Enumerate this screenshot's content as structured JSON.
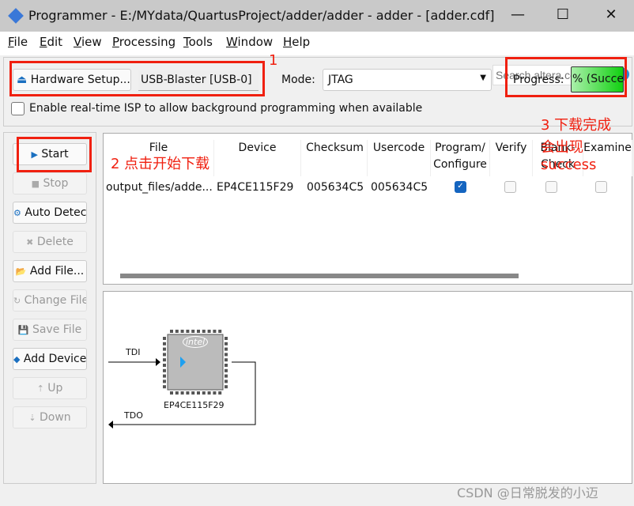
{
  "window": {
    "title": "Programmer - E:/MYdata/QuartusProject/adder/adder - adder - [adder.cdf]",
    "minimize": "—",
    "maximize": "☐",
    "close": "✕"
  },
  "menu": [
    {
      "k": "F",
      "r": "ile"
    },
    {
      "k": "E",
      "r": "dit"
    },
    {
      "k": "V",
      "r": "iew"
    },
    {
      "k": "P",
      "r": "rocessing"
    },
    {
      "k": "T",
      "r": "ools"
    },
    {
      "k": "W",
      "r": "indow"
    },
    {
      "k": "H",
      "r": "elp"
    }
  ],
  "search": {
    "placeholder": "Search altera.com"
  },
  "toolbar": {
    "hardware_setup": "Hardware Setup...",
    "hardware": "USB-Blaster [USB-0]",
    "mode_label": "Mode:",
    "mode": "JTAG",
    "progress_label": "Progress:",
    "progress_text": "% (Succes",
    "progress_percent": 100,
    "isp_label": "Enable real-time ISP to allow background programming when available"
  },
  "side_buttons": [
    {
      "label": "Start",
      "enabled": true
    },
    {
      "label": "Stop",
      "enabled": false
    },
    {
      "label": "Auto Detec",
      "enabled": true
    },
    {
      "label": "Delete",
      "enabled": false
    },
    {
      "label": "Add File...",
      "enabled": true
    },
    {
      "label": "Change File",
      "enabled": false
    },
    {
      "label": "Save File",
      "enabled": false
    },
    {
      "label": "Add Device",
      "enabled": true
    },
    {
      "label": "Up",
      "enabled": false
    },
    {
      "label": "Down",
      "enabled": false
    }
  ],
  "table": {
    "headers": [
      "File",
      "Device",
      "Checksum",
      "Usercode",
      "Program/\nConfigure",
      "Verify",
      "Blank-\nCheck",
      "Examine"
    ],
    "rows": [
      {
        "file": "output_files/adde...",
        "device": "EP4CE115F29",
        "checksum": "005634C5",
        "usercode": "005634C5",
        "program": true,
        "verify": false,
        "blank": false,
        "examine": false
      }
    ]
  },
  "diagram": {
    "tdi": "TDI",
    "tdo": "TDO",
    "device": "EP4CE115F29",
    "logo": "intel"
  },
  "annotations": {
    "a1": "1",
    "a2": "2 点击开始下载",
    "a3_1": "3 下载完成",
    "a3_2": "会出现",
    "a3_3": "success"
  },
  "watermark": "CSDN @日常脱发的小迈",
  "colors": {
    "annotation": "#f02010",
    "progress": "#22dd22",
    "checkbox": "#1565c0"
  }
}
